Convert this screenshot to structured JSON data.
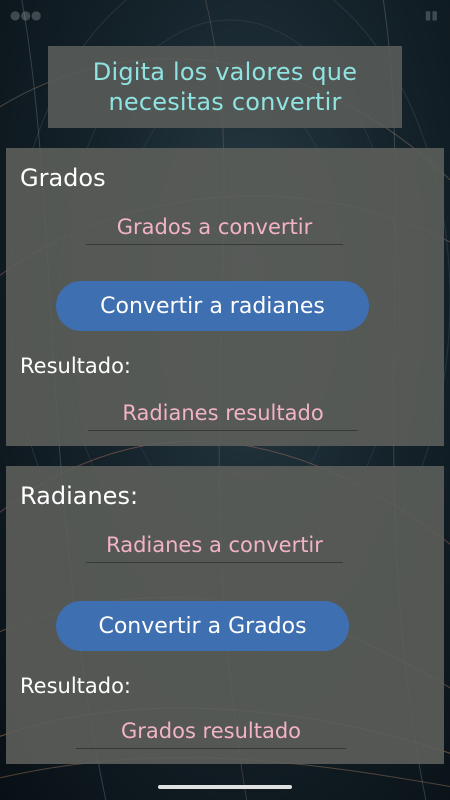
{
  "header": {
    "text": "Digita los valores que necesitas convertir"
  },
  "grados_section": {
    "title": "Grados",
    "input_placeholder": "Grados a convertir",
    "button_label": "Convertir a radianes",
    "result_label": "Resultado:",
    "result_placeholder": "Radianes resultado"
  },
  "radianes_section": {
    "title": "Radianes:",
    "input_placeholder": "Radianes a convertir",
    "button_label": "Convertir a Grados",
    "result_label": "Resultado:",
    "result_placeholder": "Grados resultado"
  },
  "colors": {
    "header_text": "#8fe3e0",
    "placeholder_text": "#f3b3c7",
    "button_bg": "#3e6fb0",
    "panel_bg": "#5c5e5a"
  }
}
